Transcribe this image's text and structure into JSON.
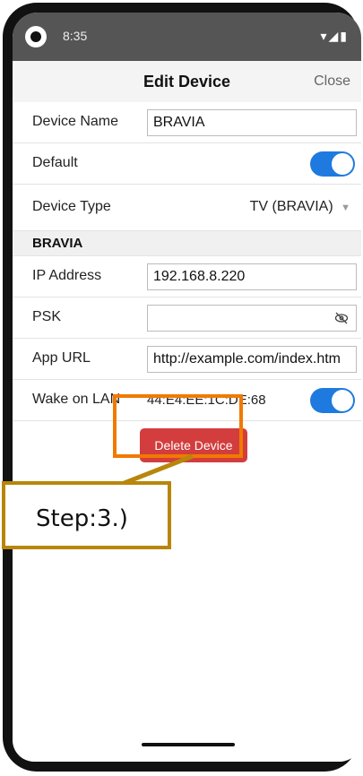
{
  "status_bar": {
    "time": "8:35",
    "icons": "▾◢▮"
  },
  "header": {
    "title": "Edit Device",
    "close_label": "Close"
  },
  "form": {
    "device_name": {
      "label": "Device Name",
      "value": "BRAVIA"
    },
    "default": {
      "label": "Default",
      "enabled": true
    },
    "device_type": {
      "label": "Device Type",
      "value": "TV (BRAVIA)"
    },
    "section_title": "BRAVIA",
    "ip_address": {
      "label": "IP Address",
      "value": "192.168.8.220"
    },
    "psk": {
      "label": "PSK",
      "value": ""
    },
    "app_url": {
      "label": "App URL",
      "value": "http://example.com/index.htm"
    },
    "wake_on_lan": {
      "label": "Wake on LAN",
      "mac": "44:E4:EE:1C:DE:68",
      "enabled": true
    }
  },
  "actions": {
    "delete_label": "Delete Device"
  },
  "annotation": {
    "step_text": "Step:3.)"
  },
  "colors": {
    "accent": "#1f7ae0",
    "delete": "#d33d3d",
    "highlight": "#f07a00",
    "callout": "#b8860b"
  }
}
